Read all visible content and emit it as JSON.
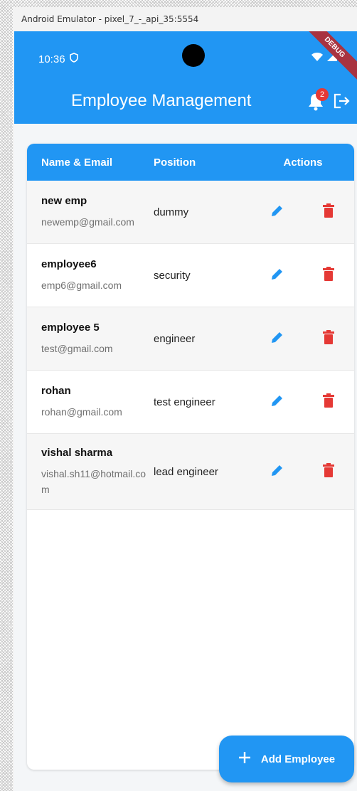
{
  "window": {
    "title": "Android Emulator - pixel_7_-_api_35:5554"
  },
  "status_bar": {
    "time": "10:36",
    "debug_label": "DEBUG"
  },
  "appbar": {
    "title": "Employee Management",
    "notification_count": "2"
  },
  "table": {
    "headers": {
      "name_email": "Name & Email",
      "position": "Position",
      "actions": "Actions"
    },
    "rows": [
      {
        "name": "new emp",
        "email": "newemp@gmail.com",
        "position": "dummy"
      },
      {
        "name": "employee6",
        "email": "emp6@gmail.com",
        "position": "security"
      },
      {
        "name": "employee 5",
        "email": "test@gmail.com",
        "position": "engineer"
      },
      {
        "name": "rohan",
        "email": "rohan@gmail.com",
        "position": "test engineer"
      },
      {
        "name": "vishal sharma",
        "email": "vishal.sh11@hotmail.com",
        "position": "lead engineer"
      }
    ]
  },
  "fab": {
    "label": "Add Employee",
    "icon": "plus-icon"
  },
  "colors": {
    "primary": "#2196f3",
    "delete": "#e53935",
    "badge": "#e53935"
  },
  "icons": {
    "edit": "pencil-icon",
    "delete": "trash-icon",
    "notifications": "bell-icon",
    "logout": "logout-icon"
  }
}
